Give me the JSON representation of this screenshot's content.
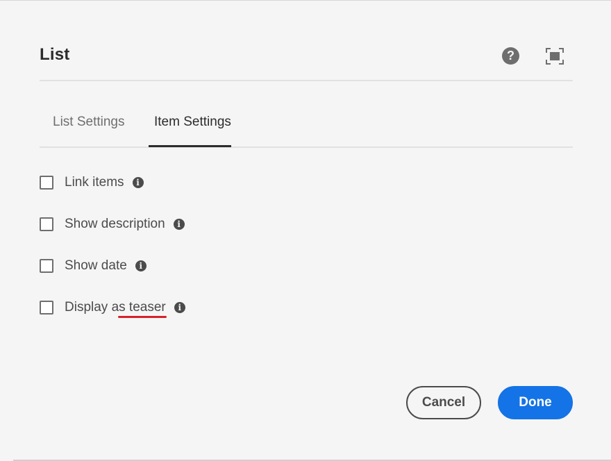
{
  "dialog": {
    "title": "List",
    "help_icon": "help-icon",
    "help_glyph": "?",
    "fullscreen_icon": "fullscreen-icon"
  },
  "tabs": [
    {
      "label": "List Settings",
      "selected": false
    },
    {
      "label": "Item Settings",
      "selected": true
    }
  ],
  "options": [
    {
      "label": "Link items",
      "checked": false,
      "info_icon": "info-icon"
    },
    {
      "label": "Show description",
      "checked": false,
      "info_icon": "info-icon"
    },
    {
      "label": "Show date",
      "checked": false,
      "info_icon": "info-icon"
    },
    {
      "label": "Display as teaser",
      "checked": false,
      "info_icon": "info-icon"
    }
  ],
  "info_glyph": "i",
  "buttons": {
    "cancel": "Cancel",
    "done": "Done"
  },
  "colors": {
    "accent": "#1473e6",
    "annotation": "#d7202a",
    "background": "#f5f5f5"
  }
}
